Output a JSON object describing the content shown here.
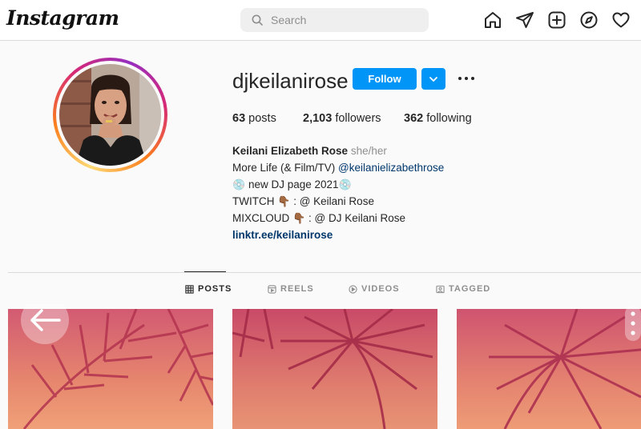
{
  "nav": {
    "logo": "Instagram",
    "search_placeholder": "Search",
    "icons": [
      "home-icon",
      "direct-message-icon",
      "new-post-icon",
      "explore-icon",
      "activity-heart-icon"
    ]
  },
  "profile": {
    "username": "djkeilanirose",
    "follow_label": "Follow",
    "stats": {
      "posts_count": "63",
      "posts_label": "posts",
      "followers_count": "2,103",
      "followers_label": "followers",
      "following_count": "362",
      "following_label": "following"
    },
    "bio": {
      "full_name": "Keilani Elizabeth Rose",
      "pronouns": "she/her",
      "line2_text": "More Life (& Film/TV) ",
      "line2_mention": "@keilanielizabethrose",
      "line3_text": "new DJ page 2021",
      "line4_prefix": "TWITCH",
      "line4_suffix": ": @ Keilani Rose",
      "line5_prefix": "MIXCLOUD",
      "line5_suffix": ": @ DJ Keilani Rose",
      "link": "linktr.ee/keilanirose"
    }
  },
  "tabs": [
    {
      "label": "POSTS",
      "icon": "grid-icon",
      "active": true
    },
    {
      "label": "REELS",
      "icon": "reels-icon",
      "active": false
    },
    {
      "label": "VIDEOS",
      "icon": "video-icon",
      "active": false
    },
    {
      "label": "TAGGED",
      "icon": "tagged-icon",
      "active": false
    }
  ],
  "colors": {
    "accent": "#0095f6",
    "text": "#262626",
    "secondary_text": "#8e8e8e",
    "link": "#00376b",
    "post_tint": "#d7566a"
  }
}
